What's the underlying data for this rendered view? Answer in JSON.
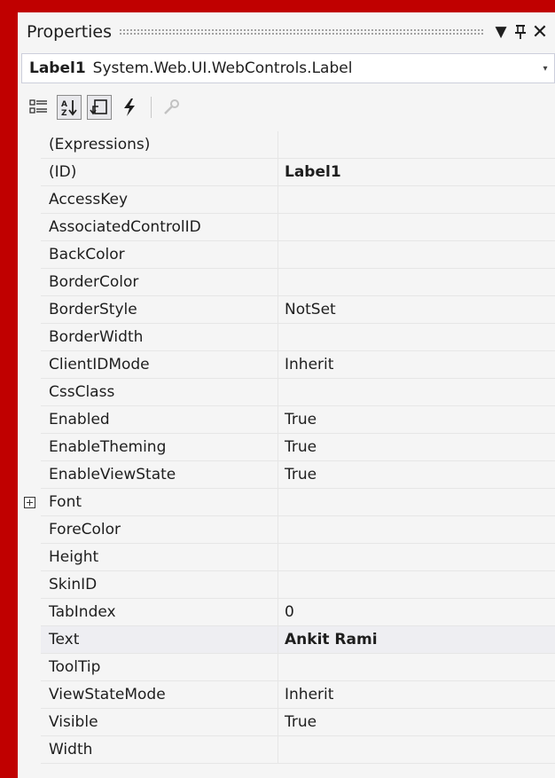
{
  "panel": {
    "title": "Properties",
    "title_icons": [
      "dropdown-icon",
      "pin-icon",
      "close-icon"
    ],
    "pin_glyph": "ф",
    "close_glyph": "✕",
    "dropdown_glyph": "▼"
  },
  "selector": {
    "object_name": "Label1",
    "object_type": "System.Web.UI.WebControls.Label",
    "arrow_glyph": "▾"
  },
  "toolbar": {
    "buttons": [
      {
        "name": "categorized-icon",
        "active": false
      },
      {
        "name": "alphabetical-icon",
        "active": true
      },
      {
        "name": "properties-icon",
        "active": true
      },
      {
        "name": "events-icon",
        "active": false
      },
      {
        "name": "property-pages-icon",
        "active": false
      }
    ]
  },
  "grid": {
    "rows": [
      {
        "name": "(Expressions)",
        "value": "",
        "bold": false
      },
      {
        "name": "(ID)",
        "value": "Label1",
        "bold": true
      },
      {
        "name": "AccessKey",
        "value": "",
        "bold": false
      },
      {
        "name": "AssociatedControlID",
        "value": "",
        "bold": false
      },
      {
        "name": "BackColor",
        "value": "",
        "bold": false
      },
      {
        "name": "BorderColor",
        "value": "",
        "bold": false
      },
      {
        "name": "BorderStyle",
        "value": "NotSet",
        "bold": false
      },
      {
        "name": "BorderWidth",
        "value": "",
        "bold": false
      },
      {
        "name": "ClientIDMode",
        "value": "Inherit",
        "bold": false
      },
      {
        "name": "CssClass",
        "value": "",
        "bold": false
      },
      {
        "name": "Enabled",
        "value": "True",
        "bold": false
      },
      {
        "name": "EnableTheming",
        "value": "True",
        "bold": false
      },
      {
        "name": "EnableViewState",
        "value": "True",
        "bold": false
      },
      {
        "name": "Font",
        "value": "",
        "bold": false,
        "expandable": true
      },
      {
        "name": "ForeColor",
        "value": "",
        "bold": false
      },
      {
        "name": "Height",
        "value": "",
        "bold": false
      },
      {
        "name": "SkinID",
        "value": "",
        "bold": false
      },
      {
        "name": "TabIndex",
        "value": "0",
        "bold": false
      },
      {
        "name": "Text",
        "value": "Ankit Rami",
        "bold": true,
        "selected": true
      },
      {
        "name": "ToolTip",
        "value": "",
        "bold": false
      },
      {
        "name": "ViewStateMode",
        "value": "Inherit",
        "bold": false
      },
      {
        "name": "Visible",
        "value": "True",
        "bold": false
      },
      {
        "name": "Width",
        "value": "",
        "bold": false
      }
    ]
  },
  "colors": {
    "frame": "#c00000",
    "panel_bg": "#f5f5f5",
    "selected_row": "#eeeef2",
    "events_icon": "#1e1e1e"
  }
}
